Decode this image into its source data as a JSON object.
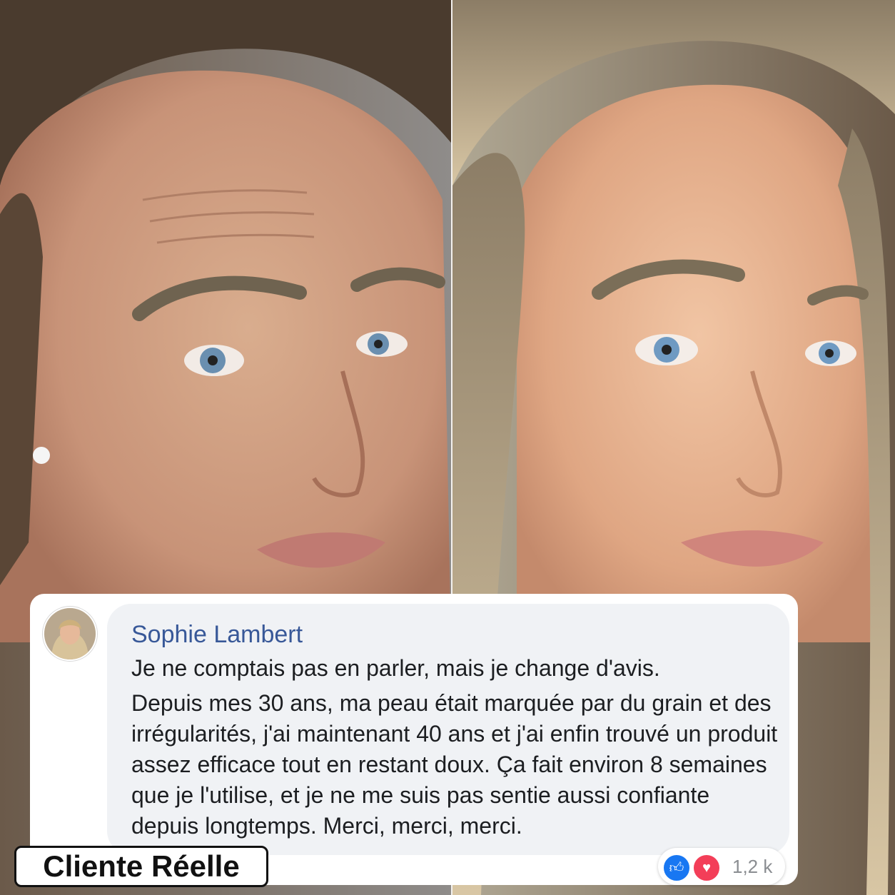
{
  "photos": {
    "before": {
      "description_icon": "portrait-photo-icon"
    },
    "after": {
      "description_icon": "portrait-photo-icon"
    }
  },
  "comment": {
    "author": "Sophie Lambert",
    "first_line": "Je ne comptais pas en parler, mais je change d'avis.",
    "body": "Depuis mes 30 ans, ma peau était marquée par du grain et des irrégularités, j'ai maintenant 40 ans et j'ai enfin trouvé un produit assez efficace tout en restant doux. Ça fait environ 8 semaines que je l'utilise, et je ne me suis pas sentie aussi confiante depuis longtemps. Merci, merci, merci.",
    "reactions": {
      "count": "1,2 k",
      "like_icon": "thumbs-up-icon",
      "love_icon": "heart-icon",
      "like_color": "#1877f2",
      "love_color": "#f33e58"
    },
    "author_color": "#385898"
  },
  "badge": {
    "label": "Cliente Réelle"
  }
}
